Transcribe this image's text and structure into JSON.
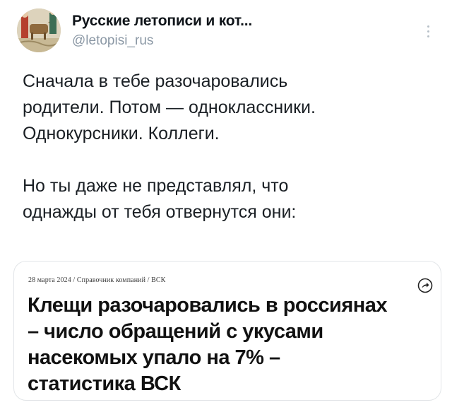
{
  "author": {
    "name": "Русские летописи и кот...",
    "handle": "@letopisi_rus",
    "avatar_icon": "medieval-miniature-avatar"
  },
  "more_icon": "vertical-ellipsis-icon",
  "tweet_text": {
    "lines": [
      "Сначала в тебе разочаровались",
      "родители. Потом — одноклассники.",
      "Однокурсники. Коллеги.",
      "",
      "Но ты даже не представлял, что",
      "однажды от тебя отвернутся они:"
    ]
  },
  "card": {
    "breadcrumb": "28 марта 2024 / Справочник компаний / ВСК",
    "share_icon": "share-arrow-icon",
    "headline_lines": [
      "Клещи разочаровались в россиянах",
      "– число обращений с укусами",
      "насекомых упало на 7% –",
      "статистика ВСК"
    ]
  },
  "colors": {
    "text": "#0f1419",
    "handle": "#8b98a5",
    "card_border": "#e2e5e8"
  }
}
